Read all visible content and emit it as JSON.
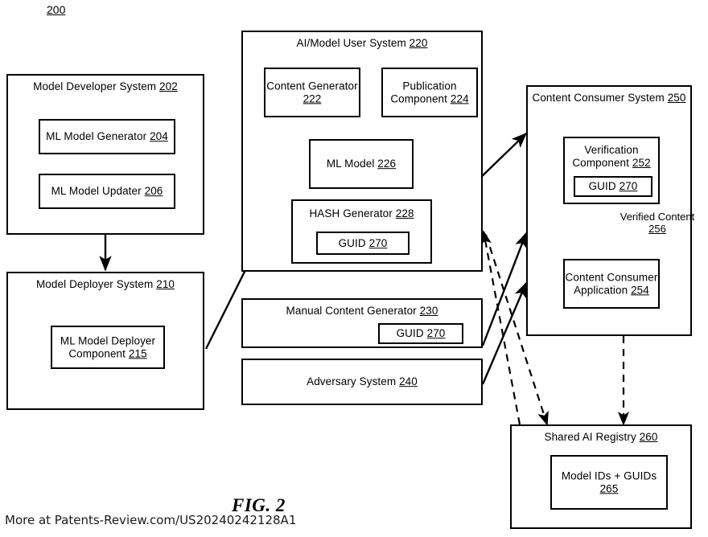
{
  "figure": {
    "number_label": "200",
    "caption": "FIG. 2",
    "watermark": "More at Patents-Review.com/US20240242128A1"
  },
  "blocks": {
    "model_developer_system": {
      "title": "Model Developer System ",
      "ref": "202",
      "children": {
        "ml_model_generator": {
          "label": "ML Model Generator ",
          "ref": "204"
        },
        "ml_model_updater": {
          "label": "ML Model Updater  ",
          "ref": "206"
        }
      }
    },
    "model_deployer_system": {
      "title": "Model Deployer System ",
      "ref": "210",
      "children": {
        "ml_model_deployer_component": {
          "label": "ML Model Deployer\nComponent ",
          "ref": "215"
        }
      }
    },
    "ai_model_user_system": {
      "title": "AI/Model User System ",
      "ref": "220",
      "children": {
        "content_generator": {
          "label": "Content Generator\n",
          "ref": "222"
        },
        "publication_component": {
          "label": "Publication\nComponent ",
          "ref": "224"
        },
        "ml_model": {
          "label": "ML Model ",
          "ref": "226"
        },
        "hash_generator": {
          "label": "HASH Generator ",
          "ref": "228"
        },
        "hash_guid": {
          "label": "GUID ",
          "ref": "270"
        }
      }
    },
    "manual_content_generator": {
      "title": "Manual Content Generator ",
      "ref": "230",
      "children": {
        "guid": {
          "label": "GUID ",
          "ref": "270"
        }
      }
    },
    "adversary_system": {
      "title": "Adversary System ",
      "ref": "240"
    },
    "content_consumer_system": {
      "title": "Content Consumer System ",
      "ref": "250",
      "children": {
        "verification_component": {
          "label": "Verification\nComponent ",
          "ref": "252"
        },
        "verification_guid": {
          "label": "GUID ",
          "ref": "270"
        },
        "content_consumer_application": {
          "label": "Content Consumer\nApplication  ",
          "ref": "254"
        }
      },
      "edges": {
        "verified_content": {
          "label": "Verified Content\n",
          "ref": "256"
        }
      }
    },
    "shared_ai_registry": {
      "title": "Shared AI Registry ",
      "ref": "260",
      "children": {
        "model_ids_guids": {
          "label": "Model IDs + GUIDs\n",
          "ref": "265"
        }
      }
    }
  },
  "colors": {
    "stroke": "#000000",
    "background": "#ffffff"
  }
}
